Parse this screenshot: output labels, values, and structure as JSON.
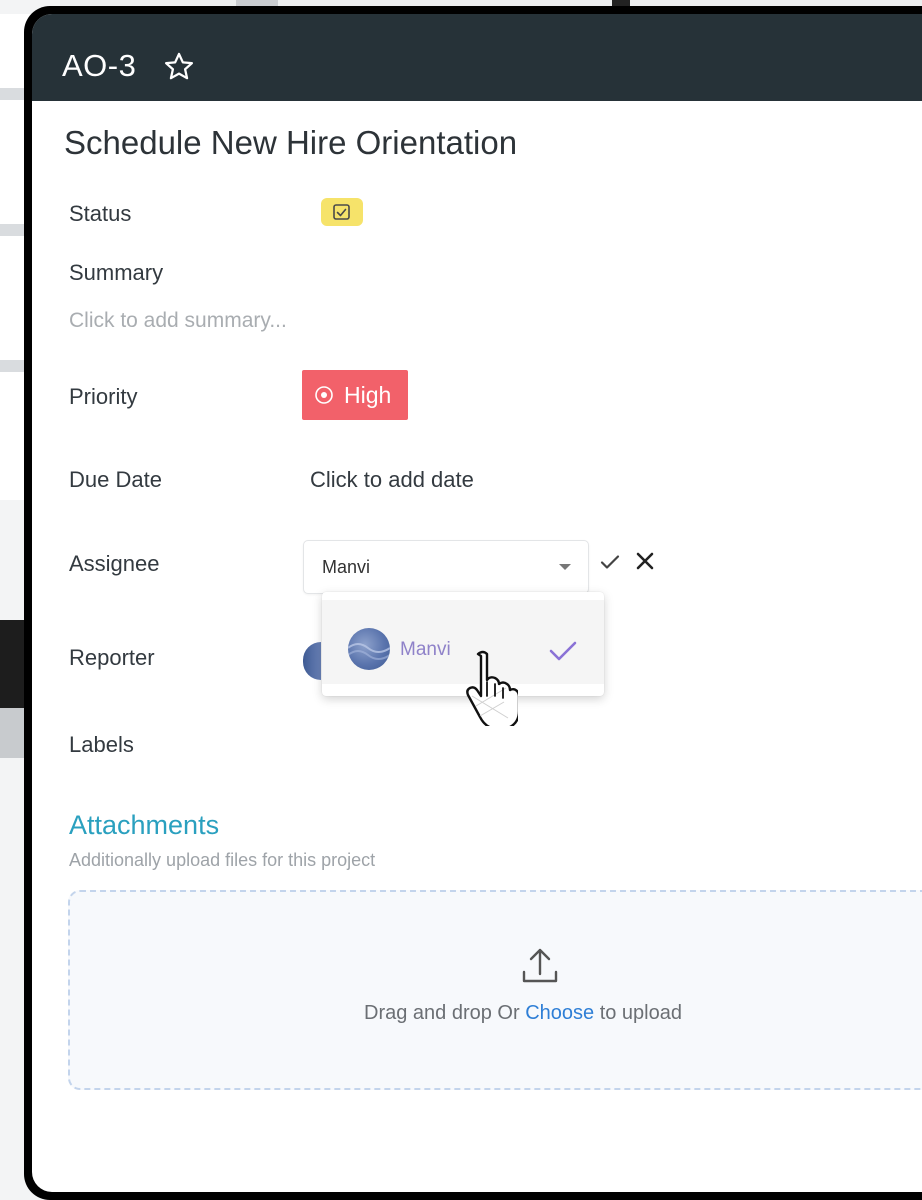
{
  "header": {
    "issue_key": "AO-3",
    "favorite_icon": "star-outline-icon"
  },
  "issue": {
    "title": "Schedule New Hire Orientation"
  },
  "fields": {
    "status_label": "Status",
    "status_icon": "checkbox-checked-icon",
    "summary_label": "Summary",
    "summary_placeholder": "Click to add summary...",
    "priority_label": "Priority",
    "priority_value": "High",
    "priority_color": "#f2616a",
    "due_date_label": "Due Date",
    "due_date_placeholder": "Click to add date",
    "assignee_label": "Assignee",
    "assignee_value": "Manvi",
    "reporter_label": "Reporter",
    "labels_label": "Labels"
  },
  "assignee_dropdown": {
    "options": [
      {
        "name": "Manvi",
        "selected": true
      }
    ]
  },
  "attachments": {
    "title": "Attachments",
    "subtitle": "Additionally upload files for this project",
    "drop_text_before": "Drag and drop Or ",
    "drop_link": "Choose",
    "drop_text_after": " to upload"
  },
  "colors": {
    "header_bg": "#263238",
    "status_chip": "#f6e36a",
    "accent_teal": "#2aa0bf",
    "link_blue": "#2f7fd6",
    "option_name": "#8f82c9"
  }
}
